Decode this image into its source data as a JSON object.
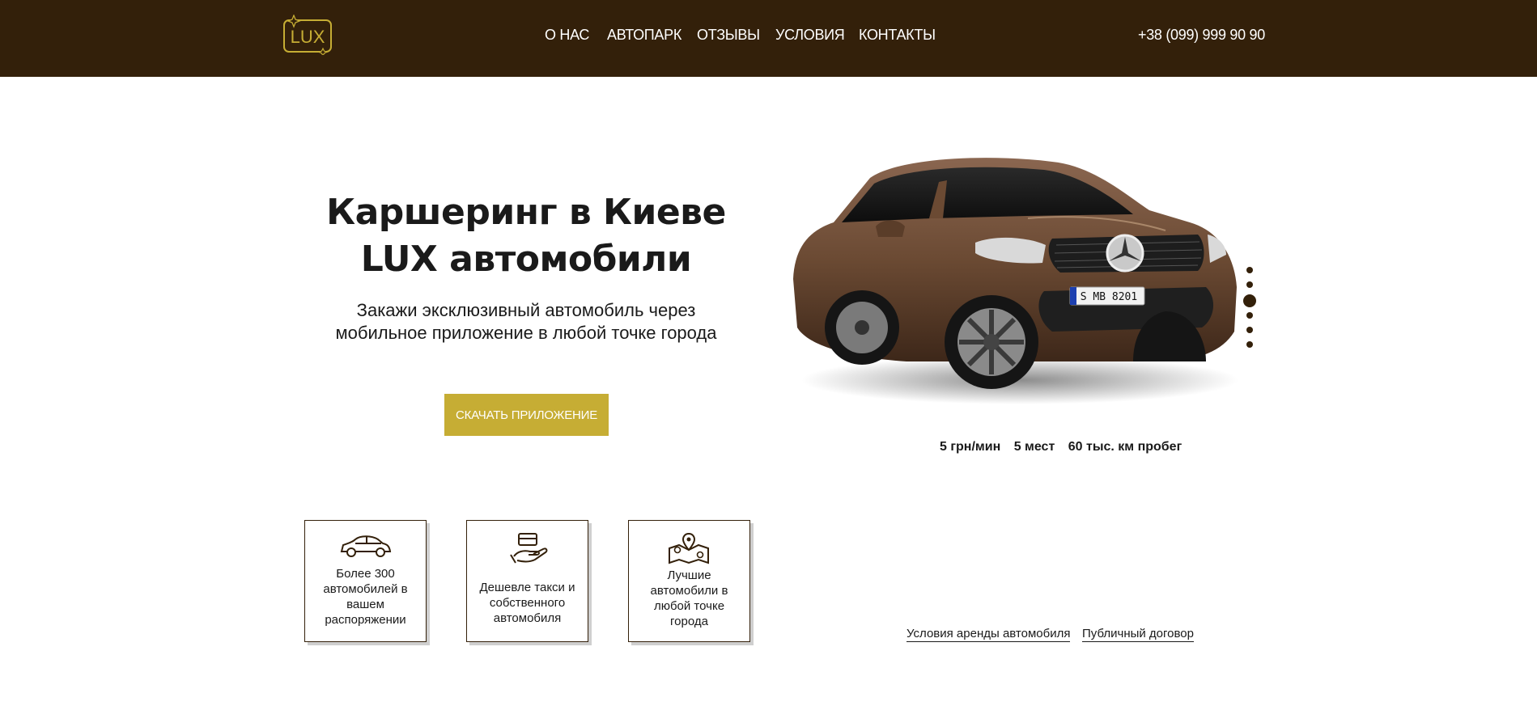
{
  "header": {
    "logo_text": "LUX",
    "nav": [
      "О НАС",
      "АВТОПАРК",
      "ОТЗЫВЫ",
      "УСЛОВИЯ",
      "КОНТАКТЫ"
    ],
    "phone": "+38 (099) 999 90 90"
  },
  "hero": {
    "title_line1": "Каршеринг в Киеве",
    "title_line2": "LUX автомобили",
    "subtitle_line1": "Закажи эксклюзивный автомобиль через",
    "subtitle_line2": "мобильное приложение в любой точке города",
    "cta_label": "СКАЧАТЬ ПРИЛОЖЕНИЕ"
  },
  "car": {
    "plate": "S MB 8201",
    "specs": [
      "5 грн/мин",
      "5 мест",
      "60 тыс. км пробег"
    ],
    "slider_total": 6,
    "slider_active": 3
  },
  "features": [
    {
      "icon": "car-icon",
      "text": [
        "Более 300",
        "автомобилей в",
        "вашем",
        "распоряжении"
      ]
    },
    {
      "icon": "card-payment-icon",
      "text": [
        "Дешевле такси и",
        "собственного",
        "автомобиля"
      ]
    },
    {
      "icon": "map-pins-icon",
      "text": [
        "Лучшие",
        "автомобили в",
        "любой точке",
        "города"
      ]
    }
  ],
  "footer_links": [
    "Условия аренды автомобиля",
    "Публичный договор"
  ],
  "colors": {
    "header_bg": "#33200a",
    "accent": "#c6ad34",
    "car_body": "#6b4a33"
  }
}
